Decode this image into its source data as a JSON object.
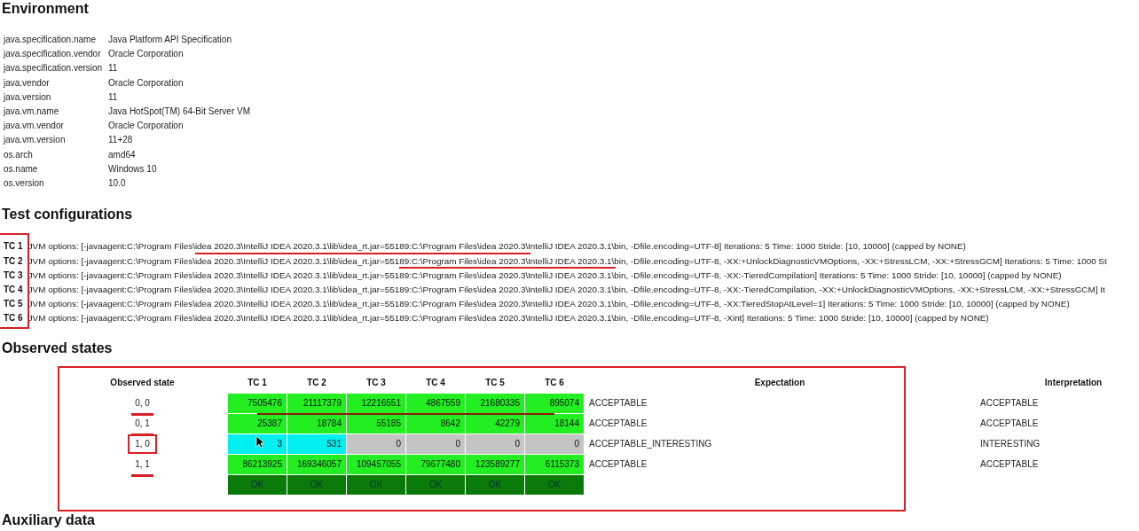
{
  "environment": {
    "title": "Environment",
    "properties": [
      {
        "key": "java.specification.name",
        "value": "Java Platform API Specification"
      },
      {
        "key": "java.specification.vendor",
        "value": "Oracle Corporation"
      },
      {
        "key": "java.specification.version",
        "value": "11"
      },
      {
        "key": "java.vendor",
        "value": "Oracle Corporation"
      },
      {
        "key": "java.version",
        "value": "11"
      },
      {
        "key": "java.vm.name",
        "value": "Java HotSpot(TM) 64-Bit Server VM"
      },
      {
        "key": "java.vm.vendor",
        "value": "Oracle Corporation"
      },
      {
        "key": "java.vm.version",
        "value": "11+28"
      },
      {
        "key": "os.arch",
        "value": "amd64"
      },
      {
        "key": "os.name",
        "value": "Windows 10"
      },
      {
        "key": "os.version",
        "value": "10.0"
      }
    ]
  },
  "test_configurations": {
    "title": "Test configurations",
    "configs": [
      {
        "label": "TC 1",
        "options": "JVM options: [-javaagent:C:\\Program Files\\idea 2020.3\\IntelliJ IDEA 2020.3.1\\lib\\idea_rt.jar=55189:C:\\Program Files\\idea 2020.3\\IntelliJ IDEA 2020.3.1\\bin, -Dfile.encoding=UTF-8] Iterations: 5 Time: 1000 Stride: [10, 10000] (capped by NONE)"
      },
      {
        "label": "TC 2",
        "options": "JVM options: [-javaagent:C:\\Program Files\\idea 2020.3\\IntelliJ IDEA 2020.3.1\\lib\\idea_rt.jar=55189:C:\\Program Files\\idea 2020.3\\IntelliJ IDEA 2020.3.1\\bin, -Dfile.encoding=UTF-8, -XX:+UnlockDiagnosticVMOptions, -XX:+StressLCM, -XX:+StressGCM] Iterations: 5 Time: 1000 St"
      },
      {
        "label": "TC 3",
        "options": "JVM options: [-javaagent:C:\\Program Files\\idea 2020.3\\IntelliJ IDEA 2020.3.1\\lib\\idea_rt.jar=55189:C:\\Program Files\\idea 2020.3\\IntelliJ IDEA 2020.3.1\\bin, -Dfile.encoding=UTF-8, -XX:-TieredCompilation] Iterations: 5 Time: 1000 Stride: [10, 10000] (capped by NONE)"
      },
      {
        "label": "TC 4",
        "options": "JVM options: [-javaagent:C:\\Program Files\\idea 2020.3\\IntelliJ IDEA 2020.3.1\\lib\\idea_rt.jar=55189:C:\\Program Files\\idea 2020.3\\IntelliJ IDEA 2020.3.1\\bin, -Dfile.encoding=UTF-8, -XX:-TieredCompilation, -XX:+UnlockDiagnosticVMOptions, -XX:+StressLCM, -XX:+StressGCM] It"
      },
      {
        "label": "TC 5",
        "options": "JVM options: [-javaagent:C:\\Program Files\\idea 2020.3\\IntelliJ IDEA 2020.3.1\\lib\\idea_rt.jar=55189:C:\\Program Files\\idea 2020.3\\IntelliJ IDEA 2020.3.1\\bin, -Dfile.encoding=UTF-8, -XX:TieredStopAtLevel=1] Iterations: 5 Time: 1000 Stride: [10, 10000] (capped by NONE)"
      },
      {
        "label": "TC 6",
        "options": "JVM options: [-javaagent:C:\\Program Files\\idea 2020.3\\IntelliJ IDEA 2020.3.1\\lib\\idea_rt.jar=55189:C:\\Program Files\\idea 2020.3\\IntelliJ IDEA 2020.3.1\\bin, -Dfile.encoding=UTF-8, -Xint] Iterations: 5 Time: 1000 Stride: [10, 10000] (capped by NONE)"
      }
    ]
  },
  "observed_states": {
    "title": "Observed states",
    "state_header": "Observed state",
    "tc_columns": [
      "TC 1",
      "TC 2",
      "TC 3",
      "TC 4",
      "TC 5",
      "TC 6"
    ],
    "expectation_header": "Expectation",
    "interpretation_header": "Interpretation",
    "rows": [
      {
        "state": "0, 0",
        "cells": [
          {
            "value": "7505476",
            "color": "#22ee22"
          },
          {
            "value": "21117379",
            "color": "#22ee22"
          },
          {
            "value": "12216551",
            "color": "#22ee22"
          },
          {
            "value": "4867559",
            "color": "#22ee22"
          },
          {
            "value": "21680335",
            "color": "#22ee22"
          },
          {
            "value": "895074",
            "color": "#22ee22"
          }
        ],
        "expectation": "ACCEPTABLE",
        "interpretation": "ACCEPTABLE"
      },
      {
        "state": "0, 1",
        "cells": [
          {
            "value": "25387",
            "color": "#22ee22"
          },
          {
            "value": "18784",
            "color": "#22ee22"
          },
          {
            "value": "55185",
            "color": "#22ee22"
          },
          {
            "value": "8642",
            "color": "#22ee22"
          },
          {
            "value": "42279",
            "color": "#22ee22"
          },
          {
            "value": "18144",
            "color": "#22ee22"
          }
        ],
        "expectation": "ACCEPTABLE",
        "interpretation": "ACCEPTABLE"
      },
      {
        "state": "1, 0",
        "cells": [
          {
            "value": "3",
            "color": "#00f0f0"
          },
          {
            "value": "531",
            "color": "#00f0f0"
          },
          {
            "value": "0",
            "color": "#c4c4c4"
          },
          {
            "value": "0",
            "color": "#c4c4c4"
          },
          {
            "value": "0",
            "color": "#c4c4c4"
          },
          {
            "value": "0",
            "color": "#c4c4c4"
          }
        ],
        "expectation": "ACCEPTABLE_INTERESTING",
        "interpretation": "INTERESTING"
      },
      {
        "state": "1, 1",
        "cells": [
          {
            "value": "86213925",
            "color": "#22ee22"
          },
          {
            "value": "169346057",
            "color": "#22ee22"
          },
          {
            "value": "109457055",
            "color": "#22ee22"
          },
          {
            "value": "79677480",
            "color": "#22ee22"
          },
          {
            "value": "123589277",
            "color": "#22ee22"
          },
          {
            "value": "6115373",
            "color": "#22ee22"
          }
        ],
        "expectation": "ACCEPTABLE",
        "interpretation": "ACCEPTABLE"
      }
    ],
    "verdicts": [
      {
        "text": "OK",
        "color": "#0a7a0a"
      },
      {
        "text": "OK",
        "color": "#0a7a0a"
      },
      {
        "text": "OK",
        "color": "#0a7a0a"
      },
      {
        "text": "OK",
        "color": "#0a7a0a"
      },
      {
        "text": "OK",
        "color": "#0a7a0a"
      },
      {
        "text": "OK",
        "color": "#0a7a0a"
      }
    ]
  },
  "auxiliary_data": {
    "title": "Auxiliary data"
  }
}
